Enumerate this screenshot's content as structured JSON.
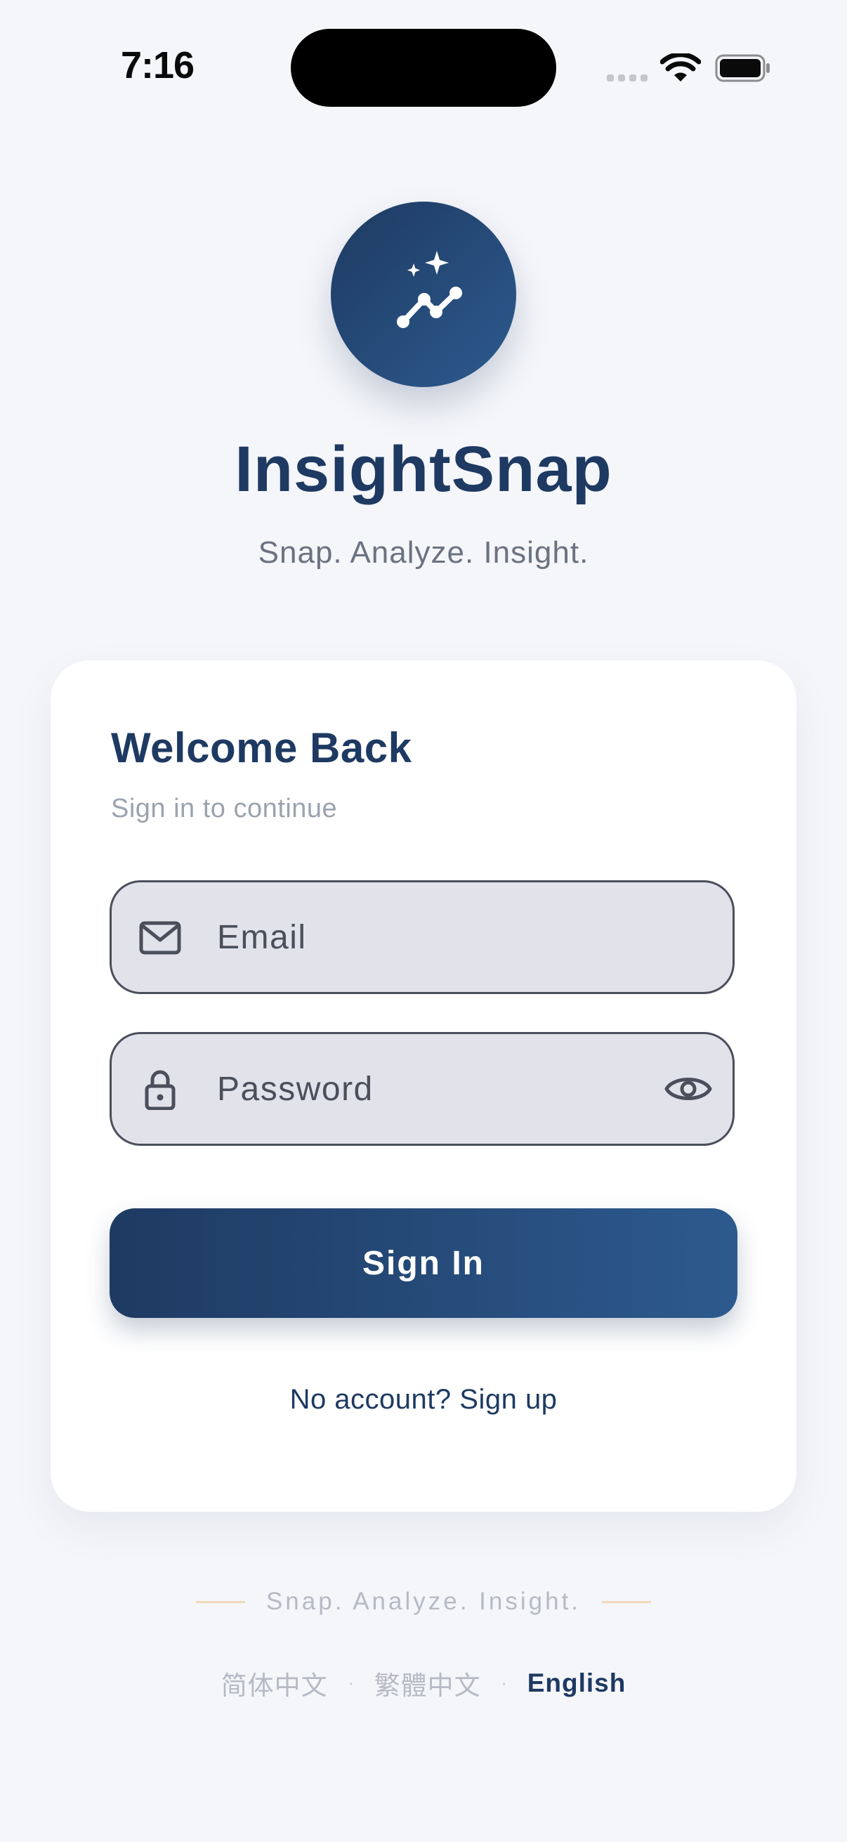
{
  "status_bar": {
    "time": "7:16"
  },
  "app": {
    "name": "InsightSnap",
    "tagline": "Snap. Analyze. Insight."
  },
  "login_card": {
    "title": "Welcome Back",
    "subtitle": "Sign in to continue",
    "email": {
      "placeholder": "Email",
      "value": ""
    },
    "password": {
      "placeholder": "Password",
      "value": ""
    },
    "sign_in_label": "Sign In",
    "signup_text": "No account? Sign up"
  },
  "footer": {
    "tagline": "Snap. Analyze. Insight.",
    "languages": [
      {
        "label": "简体中文",
        "active": false
      },
      {
        "label": "繁體中文",
        "active": false
      },
      {
        "label": "English",
        "active": true
      }
    ]
  },
  "colors": {
    "primary": "#1e3a62",
    "primary_light": "#2d5a8e",
    "background": "#f5f6fa",
    "field_bg": "#e1e2ea",
    "muted_text": "#9ca3af",
    "accent_line": "#f0d9b8"
  },
  "icons": {
    "logo": "sparkle-trend-icon",
    "email": "envelope-icon",
    "password": "lock-icon",
    "toggle_password": "eye-icon"
  }
}
